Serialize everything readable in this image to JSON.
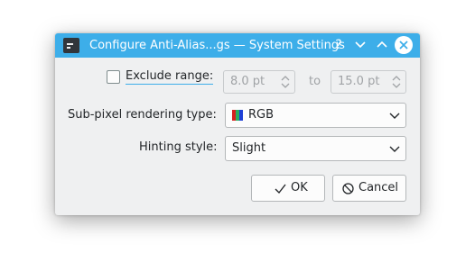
{
  "window": {
    "title": "Configure Anti-Alias...gs — System Settings",
    "help_glyph": "?"
  },
  "exclude_range": {
    "label": "Exclude range:",
    "checked": false,
    "from_value": "8.0 pt",
    "to_label": "to",
    "to_value": "15.0 pt"
  },
  "subpixel": {
    "label": "Sub-pixel rendering type:",
    "selected": "RGB",
    "icon": "rgb-stripes-icon"
  },
  "hinting": {
    "label": "Hinting style:",
    "selected": "Slight"
  },
  "buttons": {
    "ok_label": "OK",
    "cancel_label": "Cancel"
  },
  "colors": {
    "titlebar": "#3daee9",
    "window_bg": "#eff0f1",
    "text": "#232629",
    "disabled_text": "#a0a3a6",
    "rgb_red": "#d62020",
    "rgb_green": "#27ae60",
    "rgb_blue": "#1d3fd6"
  }
}
